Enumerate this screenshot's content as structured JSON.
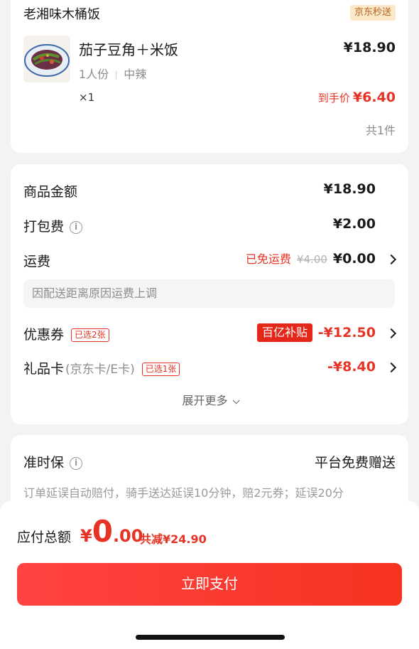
{
  "shop": {
    "name": "老湘味木桶饭",
    "tag": "京东秒送",
    "product": {
      "title": "茄子豆角＋米饭",
      "price": "¥18.90",
      "spec1": "1人份",
      "spec2": "中辣",
      "qty": "×1",
      "final_label": "到手价",
      "final_price": "¥6.40"
    },
    "total_count": "共1件"
  },
  "fees": {
    "goods_label": "商品金额",
    "goods_value": "¥18.90",
    "packing_label": "打包费",
    "packing_value": "¥2.00",
    "shipping_label": "运费",
    "shipping_free": "已免运费",
    "shipping_original": "¥4.00",
    "shipping_value": "¥0.00",
    "shipping_note": "因配送距离原因运费上调",
    "coupon_label": "优惠券",
    "coupon_chip": "已选2张",
    "coupon_badge": "百亿补贴",
    "coupon_value": "-¥12.50",
    "giftcard_label": "礼品卡",
    "giftcard_sub": "(京东卡/E卡)",
    "giftcard_chip": "已选1张",
    "giftcard_value": "-¥8.40",
    "expand_more": "展开更多"
  },
  "ontime": {
    "title": "准时保",
    "right": "平台免费赠送",
    "desc": "订单延误自动赔付，骑手送达延误10分钟，赔2元券；延误20分"
  },
  "bottom": {
    "total_label": "应付总额",
    "currency": "¥",
    "amount_int": "0",
    "amount_dec": ".00",
    "discount": "共减¥24.90",
    "pay_button": "立即支付"
  }
}
